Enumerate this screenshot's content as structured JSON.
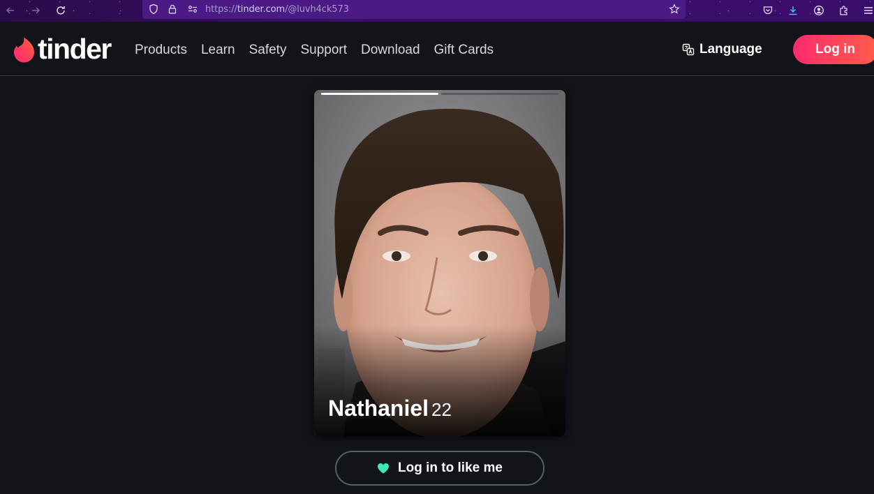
{
  "browser": {
    "url_scheme": "https://",
    "url_domain": "tinder.com",
    "url_path": "/@luvh4ck573",
    "icons": [
      "back-icon",
      "forward-icon",
      "reload-icon",
      "shield-icon",
      "lock-icon",
      "permissions-icon",
      "bookmark-star-icon",
      "pocket-icon",
      "download-icon",
      "account-icon",
      "extensions-icon",
      "menu-icon"
    ]
  },
  "nav": {
    "logo_text": "tinder",
    "links": [
      "Products",
      "Learn",
      "Safety",
      "Support",
      "Download",
      "Gift Cards"
    ],
    "language_label": "Language",
    "login_label": "Log in"
  },
  "profile": {
    "name": "Nathaniel",
    "age": "22",
    "photo_count": 2,
    "active_photo": 1
  },
  "like_button": {
    "label": "Log in to like me"
  },
  "colors": {
    "background": "#111418",
    "brand_gradient_start": "#fd2a6f",
    "brand_gradient_end": "#ff5c4a",
    "like_heart": "#3ee8b5"
  }
}
